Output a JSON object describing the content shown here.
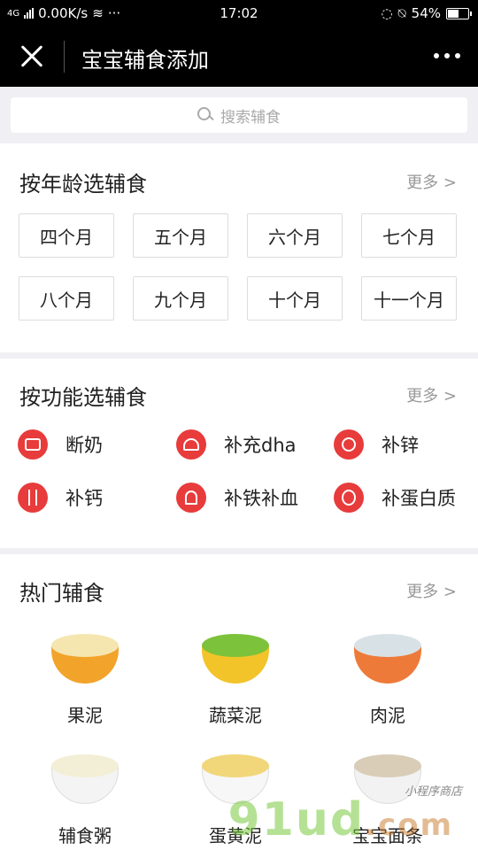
{
  "status_bar": {
    "network": "4G",
    "speed": "0.00K/s",
    "time": "17:02",
    "battery": "54%",
    "battery_level": 0.54
  },
  "nav": {
    "title": "宝宝辅食添加"
  },
  "search": {
    "placeholder": "搜索辅食"
  },
  "age_section": {
    "title": "按年龄选辅食",
    "more": "更多 >",
    "items": [
      "四个月",
      "五个月",
      "六个月",
      "七个月",
      "八个月",
      "九个月",
      "十个月",
      "十一个月"
    ]
  },
  "function_section": {
    "title": "按功能选辅食",
    "more": "更多 >",
    "items": [
      {
        "label": "断奶",
        "icon": "pot-icon"
      },
      {
        "label": "补充dha",
        "icon": "dish-cover-icon"
      },
      {
        "label": "补锌",
        "icon": "moon-icon"
      },
      {
        "label": "补钙",
        "icon": "utensils-icon"
      },
      {
        "label": "补铁补血",
        "icon": "ice-cream-icon"
      },
      {
        "label": "补蛋白质",
        "icon": "egg-icon"
      }
    ]
  },
  "hot_section": {
    "title": "热门辅食",
    "more": "更多 >",
    "items": [
      {
        "label": "果泥",
        "rim": "#f5e6b0",
        "body": "#f2a32a"
      },
      {
        "label": "蔬菜泥",
        "rim": "#7cc23b",
        "body": "#f2c42a"
      },
      {
        "label": "肉泥",
        "rim": "#d8e2e6",
        "body": "#ee7a3a"
      },
      {
        "label": "辅食粥",
        "rim": "#f3efd6",
        "body": "#f4f4f4"
      },
      {
        "label": "蛋黄泥",
        "rim": "#f1d77a",
        "body": "#f7f7f7"
      },
      {
        "label": "宝宝面条",
        "rim": "#d9cdb8",
        "body": "#f2f2f2"
      }
    ]
  },
  "watermark": {
    "brand": "91ud",
    "suffix": ".com",
    "caption": "小程序商店"
  },
  "colors": {
    "accent": "#e83b3b",
    "nav_bg": "#000000"
  }
}
